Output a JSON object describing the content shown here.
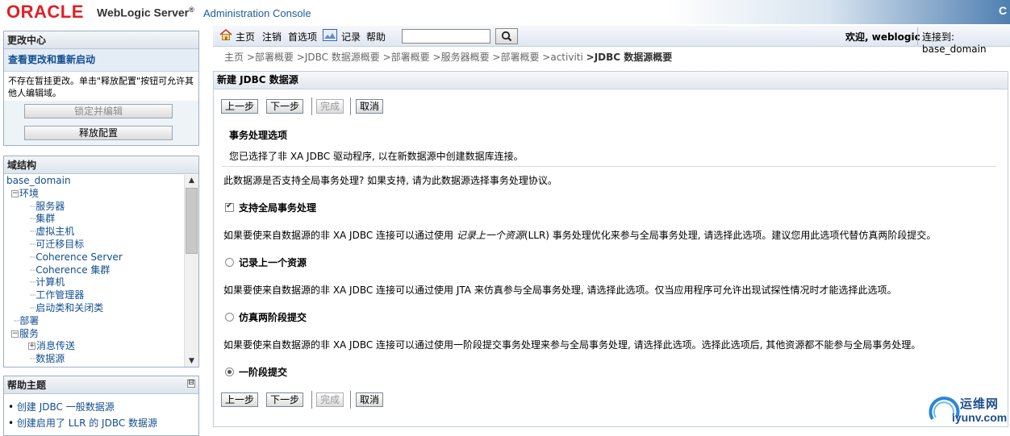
{
  "header": {
    "oracle_logo": "ORACLE",
    "product": "WebLogic Server",
    "product_mark": "®",
    "console": "Administration Console",
    "right_letter": "C"
  },
  "change_center": {
    "title": "更改中心",
    "view_changes_link": "查看更改和重新启动",
    "message": "不存在暂挂更改。单击\"释放配置\"按钮可允许其他人编辑域。",
    "lock_button": "锁定并编辑",
    "release_button": "释放配置"
  },
  "domain_structure": {
    "title": "域结构",
    "tree": [
      {
        "label": "base_domain",
        "prefix": ""
      },
      {
        "label": "环境",
        "prefix": "exp"
      },
      {
        "label": "服务器",
        "prefix": "  ·····"
      },
      {
        "label": "集群",
        "prefix": "  ·····"
      },
      {
        "label": "虚拟主机",
        "prefix": "  ·····"
      },
      {
        "label": "可迁移目标",
        "prefix": "  ·····"
      },
      {
        "label": "Coherence Server",
        "prefix": "  ·····"
      },
      {
        "label": "Coherence 集群",
        "prefix": "  ·····"
      },
      {
        "label": "计算机",
        "prefix": "  ·····"
      },
      {
        "label": "工作管理器",
        "prefix": "  ·····"
      },
      {
        "label": "启动类和关闭类",
        "prefix": "  ·····"
      },
      {
        "label": "部署",
        "prefix": "··"
      },
      {
        "label": "服务",
        "prefix": "exp"
      },
      {
        "label": "消息传送",
        "prefix": "exp2"
      },
      {
        "label": "数据源",
        "prefix": "  ·····"
      }
    ]
  },
  "help_topics": {
    "title": "帮助主题",
    "collapse": "⊟",
    "items": [
      "创建 JDBC 一般数据源",
      "创建启用了 LLR 的 JDBC 数据源"
    ]
  },
  "topnav": {
    "home": "主页",
    "logout": "注销",
    "preferences": "首选项",
    "record": "记录",
    "help": "帮助",
    "search_value": "",
    "welcome": "欢迎, weblogic",
    "connected": "连接到: base_domain"
  },
  "breadcrumb": {
    "items": [
      "主页",
      ">部署概要",
      ">JDBC 数据源概要",
      ">部署概要",
      ">服务器概要",
      ">部署概要",
      ">activiti"
    ],
    "current": ">JDBC 数据源概要"
  },
  "main": {
    "title": "新建 JDBC 数据源",
    "buttons": {
      "back": "上一步",
      "next": "下一步",
      "finish": "完成",
      "cancel": "取消"
    },
    "section_title": "事务处理选项",
    "xa_note": "您已选择了非 XA JDBC 驱动程序, 以在新数据源中创建数据库连接。",
    "global_question": "此数据源是否支持全局事务处理? 如果支持, 请为此数据源选择事务处理协议。",
    "options": {
      "support_global": {
        "label": "支持全局事务处理",
        "checked": true
      },
      "llr": {
        "label": "记录上一个资源",
        "checked": false
      },
      "emulate": {
        "label": "仿真两阶段提交",
        "checked": false
      },
      "one_phase": {
        "label": "一阶段提交",
        "checked": true
      }
    },
    "llr_desc_before": "如果要使来自数据源的非 XA JDBC 连接可以通过使用 ",
    "llr_desc_italic": "记录上一个资源",
    "llr_desc_after": "(LLR) 事务处理优化来参与全局事务处理, 请选择此选项。建议您用此选项代替仿真两阶段提交。",
    "emulate_desc": "如果要使来自数据源的非 XA JDBC 连接可以通过使用 JTA 来仿真参与全局事务处理, 请选择此选项。仅当应用程序可允许出现试探性情况时才能选择此选项。",
    "one_phase_desc": "如果要使来自数据源的非 XA JDBC 连接可以通过使用一阶段提交事务处理来参与全局事务处理, 请选择此选项。选择此选项后, 其他资源都不能参与全局事务处理。"
  },
  "watermark": {
    "cn": "运维网",
    "en": "iyunv.com"
  },
  "colors": {
    "oracle_red": "#e01f26",
    "link_blue": "#124e90",
    "header_blue": "#4f7fb0"
  }
}
